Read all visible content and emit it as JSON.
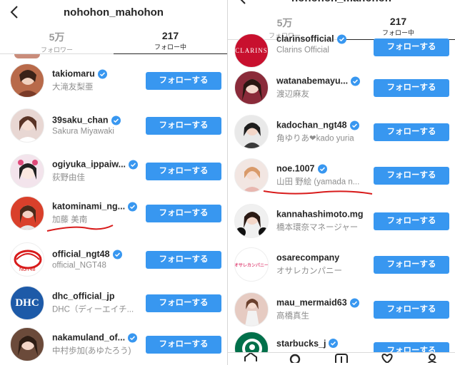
{
  "left": {
    "header": {
      "username": "nohohon_mahohon"
    },
    "tabs": [
      {
        "count": "5万",
        "label": "フォロワー"
      },
      {
        "count": "217",
        "label": "フォロー中"
      }
    ],
    "rows": [
      {
        "username": "takiomaru",
        "fullname": "大滝友梨亜",
        "button": "フォローする",
        "avatar_color": "#b86a4a"
      },
      {
        "username": "39saku_chan",
        "fullname": "Sakura Miyawaki",
        "button": "フォローする",
        "avatar_color": "#e8d7d3"
      },
      {
        "username": "ogiyuka_ippaiw...",
        "fullname": "荻野由佳",
        "button": "フォローする",
        "avatar_color": "#f3e4ec"
      },
      {
        "username": "katominami_ng...",
        "fullname": "加藤 美南",
        "button": "フォローする",
        "avatar_color": "#d9402b"
      },
      {
        "username": "official_ngt48",
        "fullname": "official_NGT48",
        "button": "フォローする",
        "avatar_color": "#ffffff"
      },
      {
        "username": "dhc_official_jp",
        "fullname": "DHC（ディーエイチ...",
        "button": "フォローする",
        "avatar_color": "#1d5aa8",
        "avatar_text": "DHC"
      },
      {
        "username": "nakamuland_of...",
        "fullname": "中村歩加(あゆたろう)",
        "button": "フォローする",
        "avatar_color": "#6b4a3a"
      }
    ]
  },
  "right": {
    "header": {
      "username": "nohohon_mahohon"
    },
    "tabs": [
      {
        "count": "5万",
        "label": "フォロワー"
      },
      {
        "count": "217",
        "label": "フォロー中"
      }
    ],
    "rows": [
      {
        "username": "clarinsofficial",
        "fullname": "Clarins Official",
        "button": "フォローする",
        "avatar_color": "#c8102e",
        "avatar_text": "CLARINS"
      },
      {
        "username": "watanabemayu...",
        "fullname": "渡辺麻友",
        "button": "フォローする",
        "avatar_color": "#8a2b3a"
      },
      {
        "username": "kadochan_ngt48",
        "fullname": "角ゆりあ❤kado yuria",
        "button": "フォローする",
        "avatar_color": "#3a3a3a"
      },
      {
        "username": "noe.1007",
        "fullname": "山田 野絵 (yamada n...",
        "button": "フォローする",
        "avatar_color": "#e8b7b0"
      },
      {
        "username": "kannahashimoto.mg",
        "fullname": "橋本環奈マネージャー",
        "button": "フォローする",
        "avatar_color": "#2c2c2c"
      },
      {
        "username": "osarecompany",
        "fullname": "オサレカンパニー",
        "button": "フォローする",
        "avatar_color": "#ffffff",
        "avatar_text": "オサレカンパニー"
      },
      {
        "username": "mau_mermaid63",
        "fullname": "高橋真生",
        "button": "フォローする",
        "avatar_color": "#e6cbc2"
      },
      {
        "username": "starbucks_j",
        "fullname": "",
        "button": "フォローする",
        "avatar_color": "#00704a"
      }
    ]
  },
  "colors": {
    "accent": "#3897f0",
    "verified": "#3897f0",
    "annotation": "#d81b1b"
  }
}
